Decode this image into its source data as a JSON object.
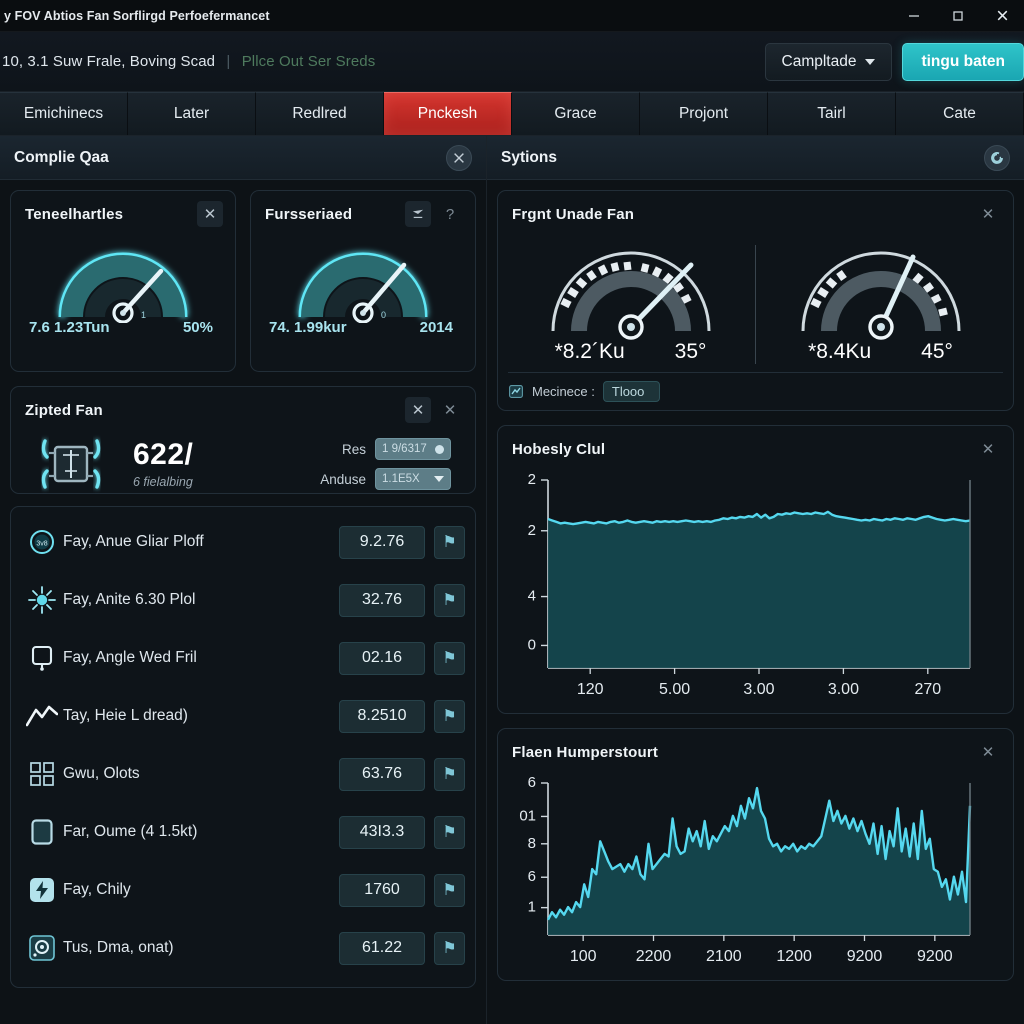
{
  "window": {
    "title": "y FOV Abtios Fan Sorflirgd Perfoefermancet",
    "minimize": "–",
    "maximize": "☐",
    "close": "✕"
  },
  "toolbar": {
    "subtitle_main": "10, 3.1 Suw Frale, Boving Scad",
    "subtitle_sep": "|",
    "subtitle_secondary": "Pllce Out Ser Sreds",
    "dropdown_label": "Campltade",
    "primary_label": "tingu baten"
  },
  "tabs": [
    {
      "label": "Emichinecs",
      "active": false
    },
    {
      "label": "Later",
      "active": false
    },
    {
      "label": "Redlred",
      "active": false
    },
    {
      "label": "Pnckesh",
      "active": true
    },
    {
      "label": "Grace",
      "active": false
    },
    {
      "label": "Projont",
      "active": false
    },
    {
      "label": "Tairl",
      "active": false
    },
    {
      "label": "Cate",
      "active": false
    }
  ],
  "left_panel": {
    "header_title": "Complie Qaa",
    "header_icon": "tools-icon",
    "gauges": [
      {
        "title": "Teneelhartles",
        "value_left": "7.6 1.23Tun",
        "value_right": "50%",
        "needle_deg": 48,
        "arc_pct": 0.68
      },
      {
        "title": "Fursseriaed",
        "value_left": "74. 1.99kur",
        "value_right": "2014",
        "needle_deg": 40,
        "arc_pct": 0.72
      }
    ],
    "fan_card": {
      "title": "Zipted Fan",
      "value": "622/",
      "sublabel": "6 fielalbing",
      "fields": [
        {
          "label": "Res",
          "value": "1 9/6317"
        },
        {
          "label": "Anduse",
          "value": "1.1E5X"
        }
      ]
    },
    "list_items": [
      {
        "icon": "badge-circle-icon",
        "label": "Fay, Anue Gliar Ploff",
        "value": "9.2.76",
        "flag": "⚑"
      },
      {
        "icon": "sunburst-icon",
        "label": "Fay, Anite 6.30 Plol",
        "value": "32.76",
        "flag": "⚑"
      },
      {
        "icon": "node-box-icon",
        "label": "Fay, Angle Wed Fril",
        "value": "02.16",
        "flag": "⚑"
      },
      {
        "icon": "zigzag-line-icon",
        "label": "Tay, Heie L dread)",
        "value": "8.2510",
        "flag": "⚑"
      },
      {
        "icon": "grid-icon",
        "label": "Gwu, Olots",
        "value": "63.76",
        "flag": "⚑"
      },
      {
        "icon": "rounded-rect-icon",
        "label": "Far, Oume (4 1.5kt)",
        "value": "43I3.3",
        "flag": "⚑"
      },
      {
        "icon": "lightning-icon",
        "label": "Fay, Chily",
        "value": "1760",
        "flag": "⚑"
      },
      {
        "icon": "disc-icon",
        "label": "Tus, Dma, onat)",
        "value": "61.22",
        "flag": "⚑"
      }
    ]
  },
  "right_panel": {
    "header_title": "Sytions",
    "header_icon": "swirl-icon",
    "dual_card": {
      "title": "Frgnt Unade Fan",
      "left_gauge": {
        "value": "*8.2´Ku",
        "angle_label": "35°",
        "needle_deg": 42
      },
      "right_gauge": {
        "value": "*8.4Ku",
        "angle_label": "45°",
        "needle_deg": 28
      },
      "footer_label": "Mecinece :",
      "footer_chip": "Tlooo",
      "footer_icon": "chart-mini-icon"
    }
  },
  "chart_data": [
    {
      "type": "area",
      "title": "Hobesly Clul",
      "xlabel": "",
      "ylabel": "",
      "ytick_labels": [
        "2",
        "2",
        "4",
        "0"
      ],
      "ytick_positions": [
        0,
        0.27,
        0.62,
        0.88
      ],
      "xtick_labels": [
        "120",
        "5.00",
        "3.00",
        "3.00",
        "270"
      ],
      "ylim": [
        0,
        2.6
      ],
      "grid": false,
      "legend": "none",
      "line_color": "#55d8ef",
      "fill_color": "#15494f",
      "values": [
        2.06,
        2.04,
        2.02,
        2.0,
        2.01,
        2.0,
        1.99,
        2.0,
        2.01,
        2.02,
        2.01,
        2.0,
        2.02,
        2.01,
        2.0,
        2.02,
        2.03,
        2.01,
        2.02,
        2.04,
        2.02,
        2.01,
        2.02,
        2.03,
        2.02,
        2.01,
        2.03,
        2.02,
        2.03,
        2.02,
        2.03,
        2.02,
        2.03,
        2.04,
        2.03,
        2.02,
        2.03,
        2.02,
        2.03,
        2.02,
        2.04,
        2.05,
        2.07,
        2.06,
        2.08,
        2.07,
        2.09,
        2.08,
        2.1,
        2.09,
        2.13,
        2.08,
        2.12,
        2.07,
        2.09,
        2.13,
        2.12,
        2.14,
        2.13,
        2.15,
        2.14,
        2.13,
        2.14,
        2.13,
        2.15,
        2.14,
        2.13,
        2.16,
        2.12,
        2.1,
        2.09,
        2.08,
        2.07,
        2.06,
        2.05,
        2.04,
        2.05,
        2.04,
        2.06,
        2.05,
        2.04,
        2.06,
        2.05,
        2.07,
        2.06,
        2.05,
        2.07,
        2.06,
        2.05,
        2.07,
        2.09,
        2.1,
        2.08,
        2.06,
        2.05,
        2.04,
        2.05,
        2.06,
        2.05,
        2.04,
        2.03,
        2.04
      ]
    },
    {
      "type": "area",
      "title": "Flaen Humperstourt",
      "xlabel": "",
      "ylabel": "",
      "ytick_labels": [
        "6",
        "01",
        "8",
        "6",
        "1"
      ],
      "ytick_positions": [
        0.0,
        0.22,
        0.4,
        0.62,
        0.82
      ],
      "xtick_labels": [
        "100",
        "2200",
        "2100",
        "1200",
        "9200",
        "9200"
      ],
      "ylim": [
        0,
        6
      ],
      "grid": false,
      "legend": "none",
      "line_color": "#55d8ef",
      "fill_color": "#15494f",
      "values": [
        0.6,
        0.9,
        0.7,
        1.0,
        0.8,
        1.1,
        0.9,
        1.3,
        1.1,
        2.0,
        1.5,
        2.6,
        2.4,
        3.7,
        3.3,
        2.9,
        2.6,
        2.7,
        2.8,
        2.5,
        2.8,
        2.6,
        3.1,
        2.4,
        2.2,
        3.6,
        2.6,
        2.8,
        3.0,
        3.2,
        3.1,
        4.6,
        3.5,
        3.2,
        3.3,
        4.2,
        3.7,
        4.1,
        3.5,
        4.5,
        3.4,
        3.9,
        3.7,
        4.0,
        4.3,
        4.1,
        4.7,
        4.3,
        5.1,
        4.6,
        5.4,
        5.0,
        5.8,
        4.9,
        4.6,
        3.8,
        3.5,
        3.6,
        3.3,
        3.5,
        3.4,
        3.6,
        3.3,
        3.5,
        3.4,
        3.6,
        3.5,
        3.7,
        3.9,
        4.6,
        5.3,
        4.5,
        4.9,
        4.4,
        4.7,
        4.2,
        4.6,
        4.1,
        4.5,
        4.0,
        3.6,
        4.4,
        3.2,
        4.3,
        3.0,
        4.1,
        3.5,
        5.0,
        3.3,
        4.2,
        3.1,
        4.4,
        3.0,
        4.9,
        3.4,
        3.8,
        2.6,
        2.5,
        1.9,
        2.2,
        1.4,
        2.3,
        1.6,
        2.5,
        1.3,
        5.1
      ]
    }
  ]
}
